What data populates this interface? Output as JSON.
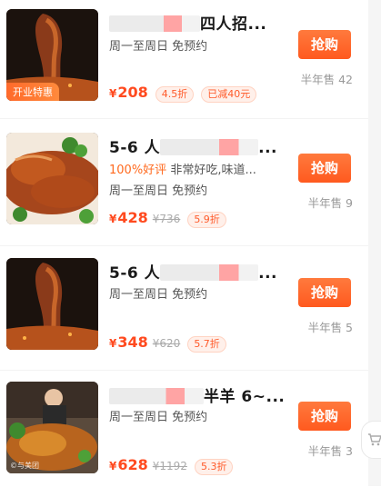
{
  "items": [
    {
      "title_tail": "四人招...",
      "thumb_badge": "开业特惠",
      "schedule": "周一至周日 免预约",
      "price": "208",
      "orig_price": "",
      "discount": "4.5折",
      "extra_tag": "已减40元",
      "buy_label": "抢购",
      "sold": "半年售 42"
    },
    {
      "title_head": "5-6 人",
      "title_tail": "...",
      "review_good": "100%好评",
      "review_text": "非常好吃,味道...",
      "schedule": "周一至周日 免预约",
      "price": "428",
      "orig_price": "736",
      "discount": "5.9折",
      "buy_label": "抢购",
      "sold": "半年售 9"
    },
    {
      "title_head": "5-6 人",
      "title_tail": "...",
      "schedule": "周一至周日 免预约",
      "price": "348",
      "orig_price": "620",
      "discount": "5.7折",
      "buy_label": "抢购",
      "sold": "半年售 5"
    },
    {
      "title_tail": "半羊 6~...",
      "schedule": "周一至周日 免预约",
      "price": "628",
      "orig_price": "1192",
      "discount": "5.3折",
      "buy_label": "抢购",
      "sold": "半年售 3"
    }
  ],
  "currency": "¥",
  "watermark": "©与美团",
  "icons": {
    "cart": "cart-icon"
  },
  "colors": {
    "accent": "#ff5a1f",
    "price": "#ff4a1f",
    "muted": "#999999"
  }
}
